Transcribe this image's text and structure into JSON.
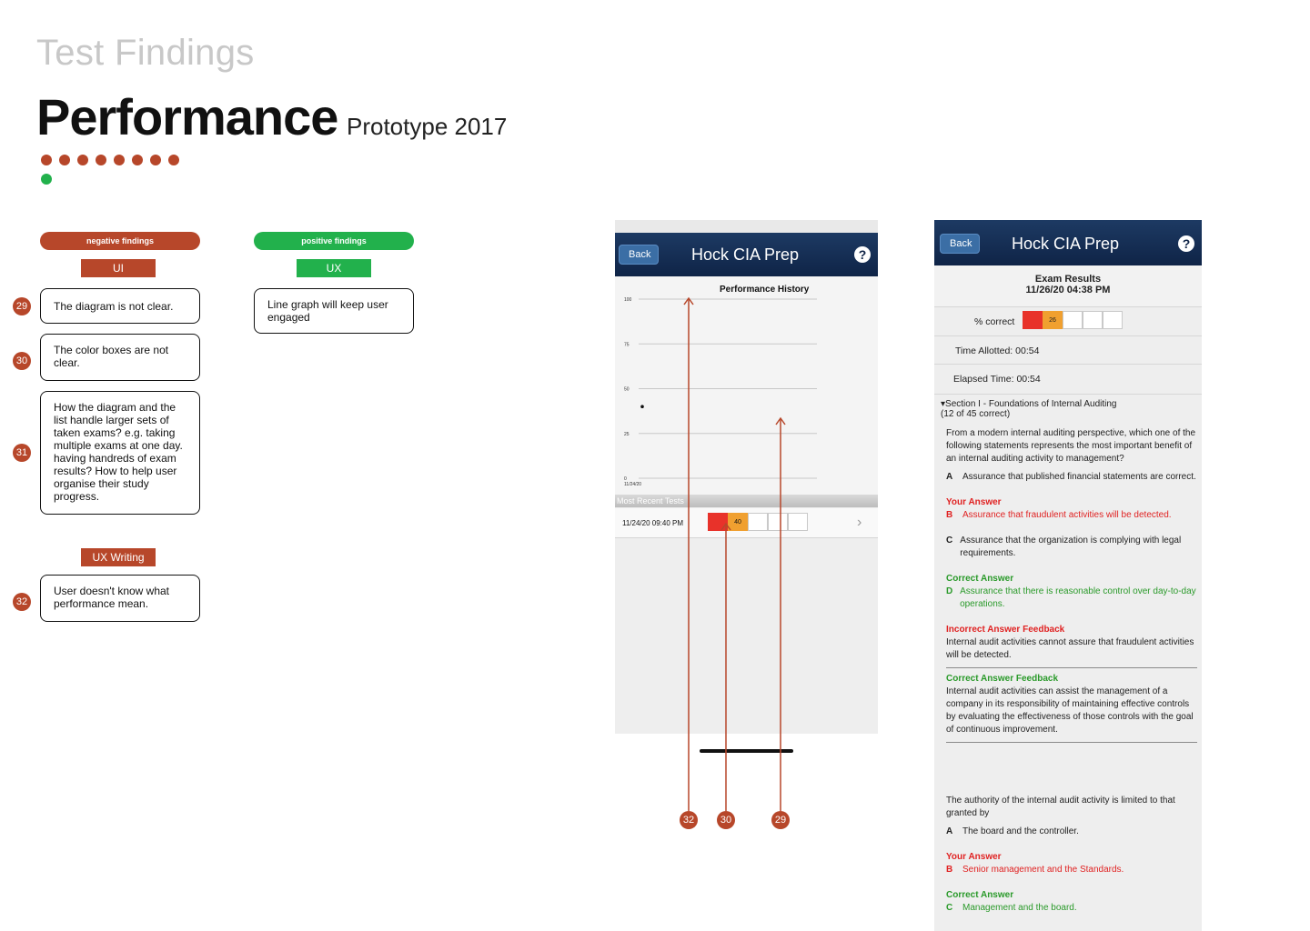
{
  "header": {
    "eyebrow": "Test Findings",
    "title": "Performance",
    "subtitle": "Prototype 2017"
  },
  "progress_dots": {
    "total": 9,
    "filled_colour": "#b7472a",
    "current_colour": "#22b14c"
  },
  "colors": {
    "negative": "#b7472a",
    "positive": "#22b14c",
    "navbar": "#0f2447"
  },
  "negative": {
    "label": "negative findings",
    "groups": [
      {
        "tag": "UI",
        "items": [
          {
            "num": "29",
            "text": "The diagram is not clear."
          },
          {
            "num": "30",
            "text": "The color boxes are not clear."
          },
          {
            "num": "31",
            "text": "How the diagram and the list handle larger sets of taken exams? e.g. taking multiple exams at one day. having handreds of exam results? How to help user organise their study progress."
          }
        ]
      },
      {
        "tag": "UX Writing",
        "items": [
          {
            "num": "32",
            "text": "User doesn't know what performance mean."
          }
        ]
      }
    ]
  },
  "positive": {
    "label": "positive findings",
    "groups": [
      {
        "tag": "UX",
        "items": [
          {
            "text": "Line graph will keep user engaged"
          }
        ]
      }
    ]
  },
  "phone1": {
    "back": "Back",
    "app_title": "Hock CIA Prep",
    "help": "?",
    "chart_title": "Performance History",
    "y_ticks": [
      "100",
      "75",
      "50",
      "25",
      "0"
    ],
    "x_tick": "11/24/20",
    "section": "Most Recent Tests",
    "recent_date": "11/24/20 09:40 PM",
    "recent_score": "40",
    "callouts": [
      "32",
      "30",
      "29"
    ]
  },
  "chart_data": {
    "type": "scatter",
    "title": "Performance History",
    "x": [
      "11/24/20"
    ],
    "y": [
      40
    ],
    "ylim": [
      0,
      100
    ],
    "y_ticks": [
      0,
      25,
      50,
      75,
      100
    ],
    "grid": true
  },
  "phone2": {
    "back": "Back",
    "app_title": "Hock CIA Prep",
    "help": "?",
    "results_title": "Exam Results",
    "results_date": "11/26/20 04:38 PM",
    "pct_label": "% correct",
    "pct_value": "26",
    "time_allotted": "Time Allotted:  00:54",
    "elapsed_time": "Elapsed Time:  00:54",
    "section_title": "Section I - Foundations of Internal Auditing",
    "section_count": "(12 of 45 correct)",
    "q1": {
      "question": "From a modern internal auditing perspective, which one of the following statements represents the most important benefit of an internal auditing activity to management?",
      "a": "Assurance that published financial statements are correct.",
      "your_label": "Your Answer",
      "b": "Assurance that fraudulent activities will be detected.",
      "c": "Assurance that the organization is complying with legal requirements.",
      "correct_label": "Correct Answer",
      "d": "Assurance that there is reasonable control over day-to-day operations.",
      "incorrect_fb_label": "Incorrect Answer Feedback",
      "incorrect_fb": "Internal audit activities cannot assure that fraudulent activities will be detected.",
      "correct_fb_label": "Correct Answer Feedback",
      "correct_fb": "Internal audit activities can assist the management of a company in its responsibility of maintaining effective controls by evaluating the effectiveness of those controls with the goal of continuous improvement."
    },
    "q2": {
      "question": "The authority of the internal audit activity is limited to that granted by",
      "a": "The board and the controller.",
      "your_label": "Your Answer",
      "b": "Senior management and the Standards.",
      "correct_label": "Correct Answer",
      "c": "Management and the board."
    }
  }
}
